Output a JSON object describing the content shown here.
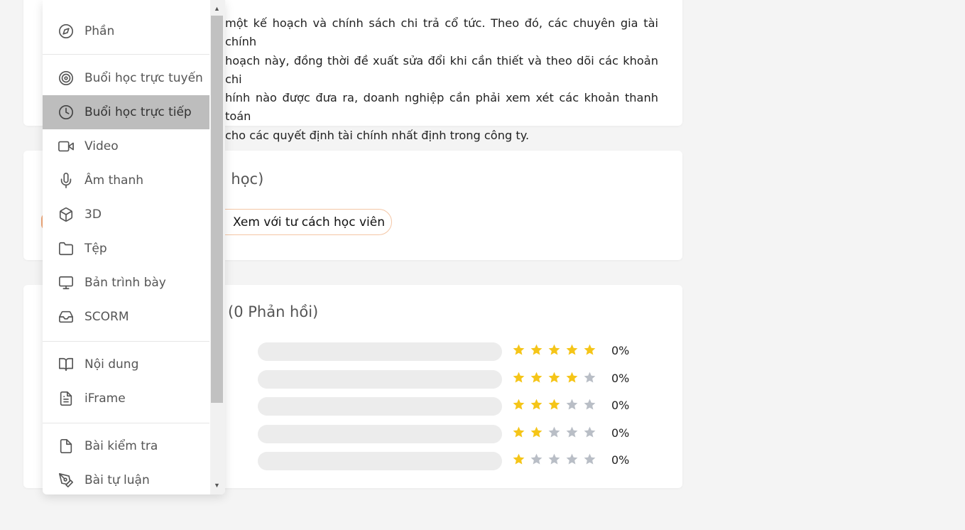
{
  "course": {
    "description_lines": [
      "một kế hoạch và chính sách chi trả cổ tức. Theo đó, các chuyên gia tài chính",
      "hoạch này, đồng thời đề xuất sửa đổi khi cần thiết và theo dõi các khoản chi",
      "hính nào được đưa ra, doanh nghiệp cần phải xem xét các khoản thanh toán",
      "cho các quyết định tài chính nhất định trong công ty."
    ],
    "lessons_title_fragment": "ai học)",
    "student_view_button": "Xem với tư cách học viên",
    "reviews_title_fragment": "(0 Phản hồi)"
  },
  "ratings": [
    {
      "stars": 5,
      "percent_label": "0%",
      "fraction": 0
    },
    {
      "stars": 4,
      "percent_label": "0%",
      "fraction": 0
    },
    {
      "stars": 3,
      "percent_label": "0%",
      "fraction": 0
    },
    {
      "stars": 2,
      "percent_label": "0%",
      "fraction": 0
    },
    {
      "stars": 1,
      "percent_label": "0%",
      "fraction": 0
    }
  ],
  "colors": {
    "star_filled": "#f5c518",
    "star_empty": "#b9bec6",
    "menu_active_bg": "#bdbdbd",
    "button_border": "#f4c6a5"
  },
  "menu": {
    "items": [
      {
        "label": "Phần",
        "icon": "compass-icon"
      },
      {
        "label": "Buổi học trực tuyến",
        "icon": "target-icon"
      },
      {
        "label": "Buổi học trực tiếp",
        "icon": "clock-icon",
        "active": true
      },
      {
        "label": "Video",
        "icon": "video-camera-icon"
      },
      {
        "label": "Âm thanh",
        "icon": "microphone-icon"
      },
      {
        "label": "3D",
        "icon": "cube-icon"
      },
      {
        "label": "Tệp",
        "icon": "folder-icon"
      },
      {
        "label": "Bản trình bày",
        "icon": "monitor-icon"
      },
      {
        "label": "SCORM",
        "icon": "inbox-icon"
      },
      {
        "label": "Nội dung",
        "icon": "book-open-icon"
      },
      {
        "label": "iFrame",
        "icon": "file-text-icon"
      },
      {
        "label": "Bài kiểm tra",
        "icon": "file-icon"
      },
      {
        "label": "Bài tự luận",
        "icon": "pen-tool-icon"
      }
    ]
  }
}
